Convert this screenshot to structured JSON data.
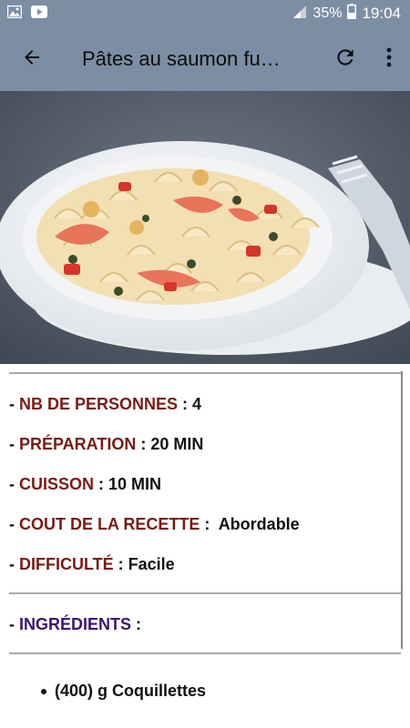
{
  "status_bar": {
    "battery_percent": "35%",
    "time": "19:04",
    "icons": [
      "image-notification-icon",
      "youtube-notification-icon",
      "signal-icon",
      "battery-icon"
    ]
  },
  "app_bar": {
    "title": "Pâtes au saumon fu…",
    "icons": [
      "back-arrow-icon",
      "refresh-icon",
      "more-vert-icon"
    ]
  },
  "hero_image": {
    "subject": "pasta-salmon-photo"
  },
  "recipe": {
    "rows": [
      {
        "prefix": "- ",
        "key": "NB DE PERSONNES",
        "sep": " : ",
        "value": "4"
      },
      {
        "prefix": "- ",
        "key": "PRÉPARATION",
        "sep": " : ",
        "value": "20 MIN"
      },
      {
        "prefix": "- ",
        "key": "CUISSON",
        "sep": " : ",
        "value": "10 MIN"
      },
      {
        "prefix": "- ",
        "key": "COUT DE LA RECETTE",
        "sep": " :  ",
        "value": "Abordable"
      },
      {
        "prefix": "- ",
        "key": "DIFFICULTÉ",
        "sep": " : ",
        "value": "Facile"
      }
    ],
    "ingredients_header": {
      "prefix": "- ",
      "key": "INGRÉDIENTS",
      "sep": " :"
    },
    "ingredients": [
      "(400) g Coquillettes"
    ]
  },
  "colors": {
    "bar": "#7c8ea3",
    "key_red": "#7a1a14",
    "key_purple": "#3a1670"
  }
}
